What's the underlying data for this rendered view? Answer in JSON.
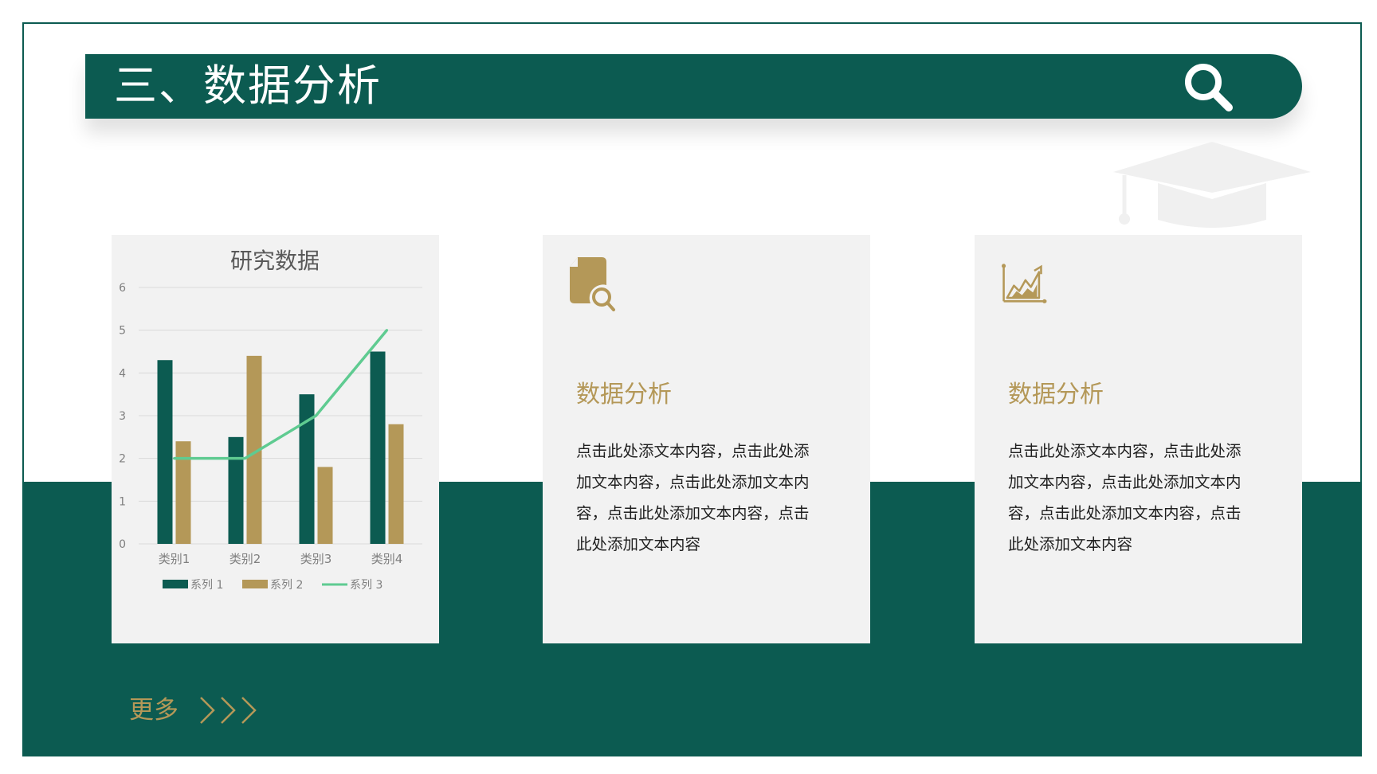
{
  "header": {
    "title": "三、数据分析",
    "search_icon": "search-icon"
  },
  "decoration": {
    "icon": "graduation-cap-icon"
  },
  "colors": {
    "primary": "#0c5b51",
    "accent": "#b49858",
    "line": "#5fcb91",
    "card_bg": "#f2f2f2"
  },
  "chart_card": {
    "chart_data": {
      "type": "bar",
      "title": "研究数据",
      "categories": [
        "类别1",
        "类别2",
        "类别3",
        "类别4"
      ],
      "ylim": [
        0,
        6
      ],
      "yticks": [
        "0",
        "1",
        "2",
        "3",
        "4",
        "5",
        "6"
      ],
      "grid": true,
      "legend_position": "bottom",
      "series": [
        {
          "name": "系列 1",
          "kind": "bar",
          "color": "#0c5b51",
          "values": [
            4.3,
            2.5,
            3.5,
            4.5
          ]
        },
        {
          "name": "系列 2",
          "kind": "bar",
          "color": "#b49858",
          "values": [
            2.4,
            4.4,
            1.8,
            2.8
          ]
        },
        {
          "name": "系列 3",
          "kind": "line",
          "color": "#5fcb91",
          "values": [
            2,
            2,
            3,
            5
          ]
        }
      ]
    }
  },
  "cards": [
    {
      "icon": "document-search-icon",
      "heading": "数据分析",
      "body": "点击此处添文本内容，点击此处添\n加文本内容，点击此处添加文本内\n容，点击此处添加文本内容，点击\n此处添加文本内容"
    },
    {
      "icon": "area-chart-icon",
      "heading": "数据分析",
      "body": "点击此处添文本内容，点击此处添\n加文本内容，点击此处添加文本内\n容，点击此处添加文本内容，点击\n此处添加文本内容"
    }
  ],
  "footer": {
    "more_label": "更多",
    "more_icon": "chevrons-right-icon"
  }
}
